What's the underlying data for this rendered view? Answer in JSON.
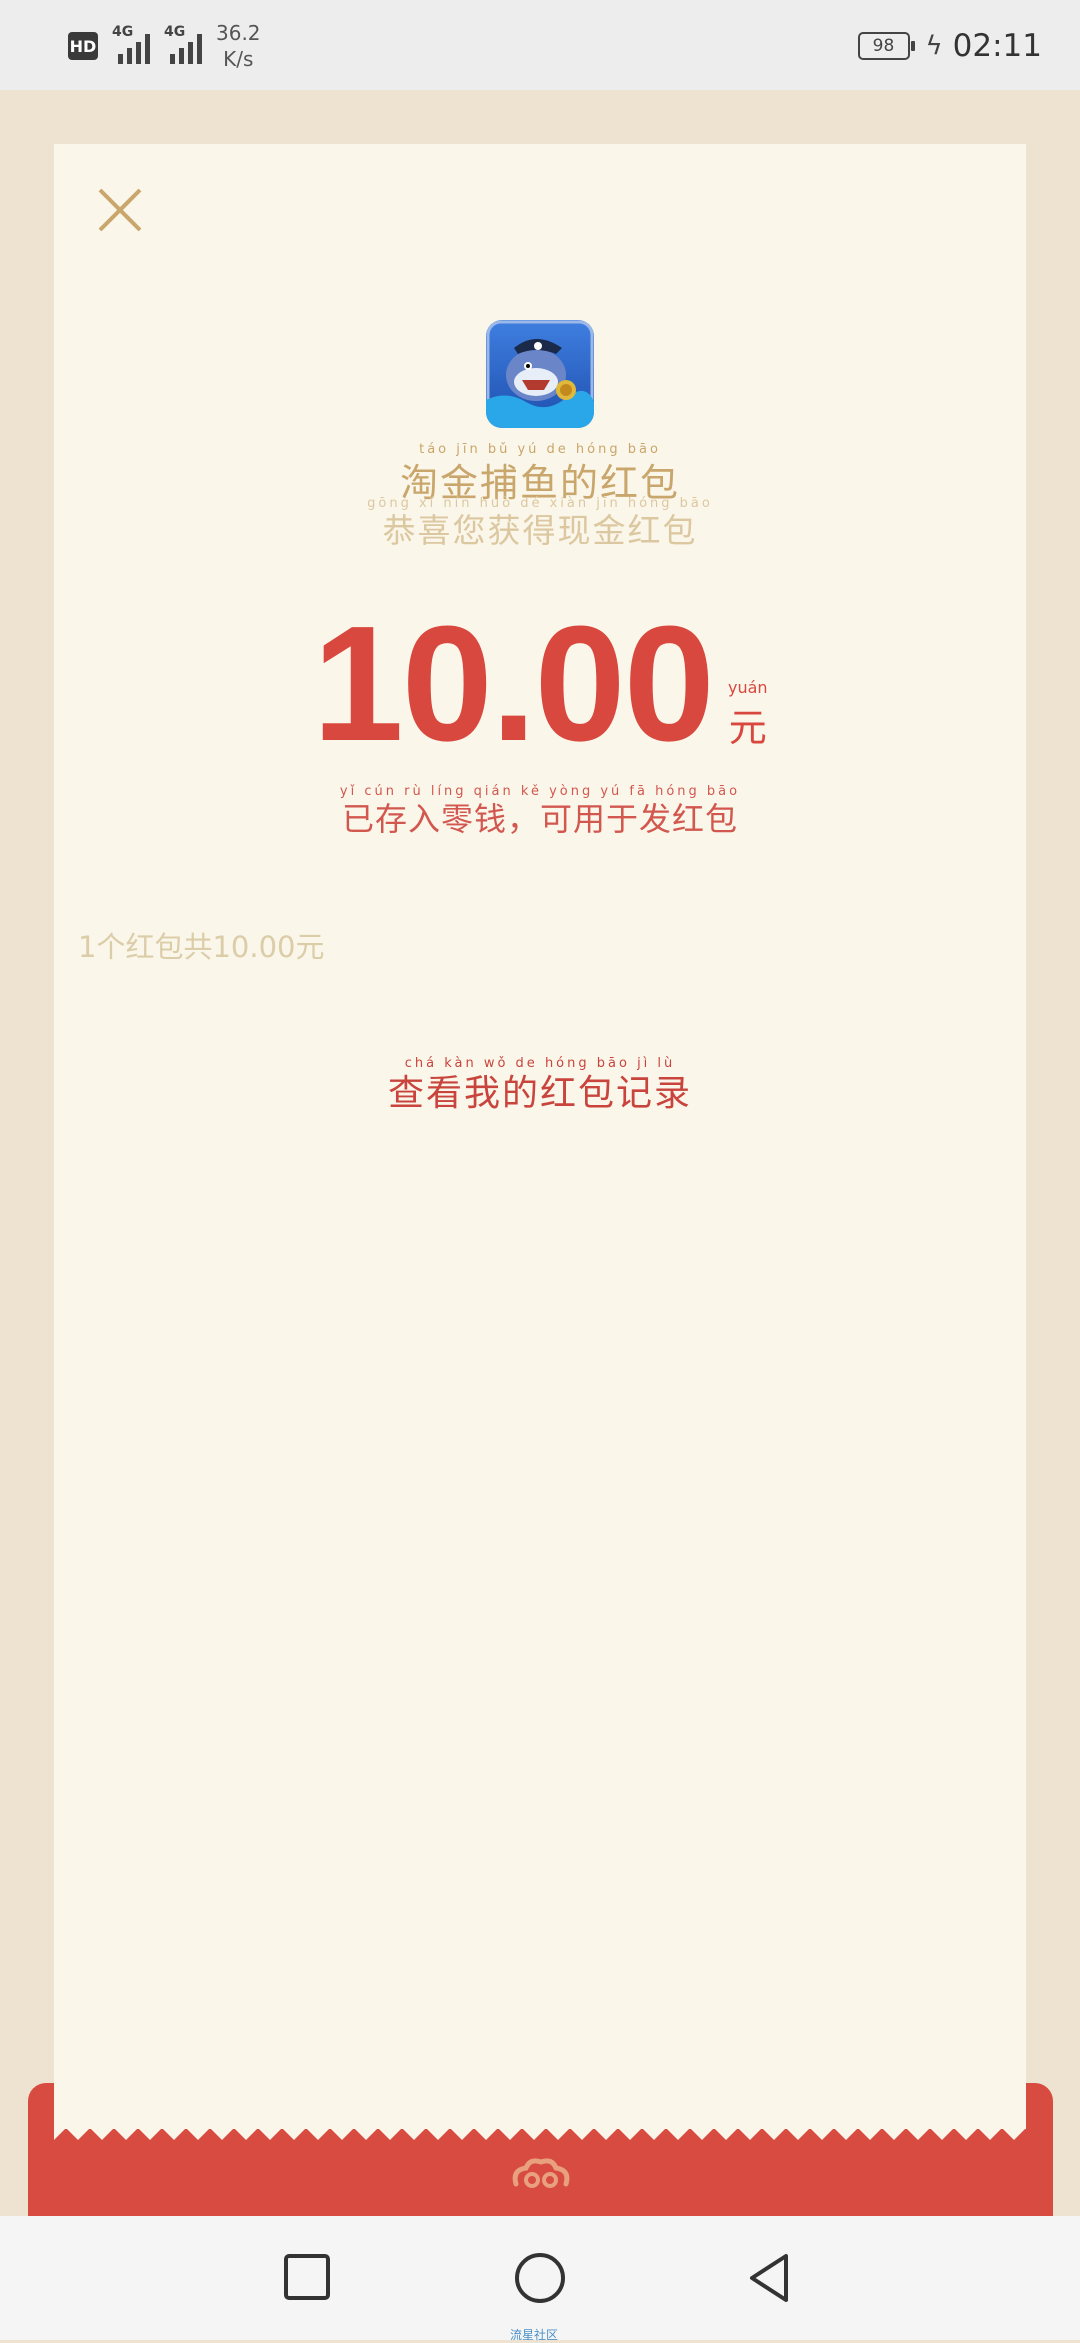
{
  "status_bar": {
    "hd": "HD",
    "network1": "4G",
    "network2": "4G",
    "speed_value": "36.2",
    "speed_unit": "K/s",
    "battery": "98",
    "time": "02:11"
  },
  "card": {
    "app_name": "淘金捕鱼的红包",
    "app_name_pinyin": "táo jīn bǔ yú de hóng bāo",
    "subtitle": "恭喜您获得现金红包",
    "subtitle_pinyin": "gōng xǐ nín huò dé xiàn jīn hóng bāo",
    "amount": "10.00",
    "currency": "元",
    "currency_pinyin": "yuán",
    "stored_note": "已存入零钱，可用于发红包",
    "stored_note_pinyin": "yǐ cún rù líng qián kě yòng yú fā hóng bāo",
    "packet_count": "1个红包共10.00元",
    "record_link": "查看我的红包记录",
    "record_link_pinyin": "chá kàn wǒ de hóng bāo jì lù"
  },
  "watermark": "流星社区",
  "icons": {
    "close": "close-icon",
    "app": "app-icon",
    "cloud": "cloud-icon",
    "recents": "square-icon",
    "home": "circle-icon",
    "back": "triangle-back-icon"
  },
  "colors": {
    "accent_red": "#d9483f",
    "gold": "#c9a66b",
    "card_bg": "#fbf6ea",
    "page_bg": "#ede3d0"
  }
}
